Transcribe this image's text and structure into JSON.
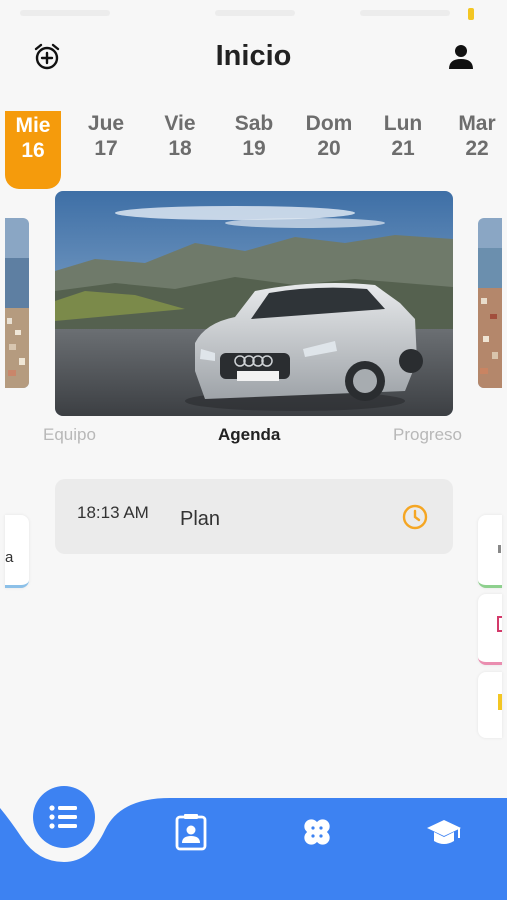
{
  "header": {
    "title": "Inicio",
    "alarm_icon": "alarm-plus-icon",
    "profile_icon": "user-icon"
  },
  "days": [
    {
      "name": "Mie",
      "num": "16",
      "selected": true
    },
    {
      "name": "Jue",
      "num": "17",
      "selected": false
    },
    {
      "name": "Vie",
      "num": "18",
      "selected": false
    },
    {
      "name": "Sab",
      "num": "19",
      "selected": false
    },
    {
      "name": "Dom",
      "num": "20",
      "selected": false
    },
    {
      "name": "Lun",
      "num": "21",
      "selected": false
    },
    {
      "name": "Mar",
      "num": "22",
      "selected": false
    }
  ],
  "tabs": [
    {
      "label": "Equipo",
      "active": false
    },
    {
      "label": "Agenda",
      "active": true
    },
    {
      "label": "Progreso",
      "active": false
    }
  ],
  "task": {
    "time": "18:13 AM",
    "label": "Plan",
    "icon": "clock-icon"
  },
  "side_preview": {
    "left_letter": "a"
  },
  "bottom_nav": {
    "items": [
      "list-icon",
      "contact-card-icon",
      "bandage-icon",
      "graduation-cap-icon"
    ]
  },
  "colors": {
    "accent": "#f59b0c",
    "nav": "#3d82f2",
    "background": "#f7f7f7"
  }
}
